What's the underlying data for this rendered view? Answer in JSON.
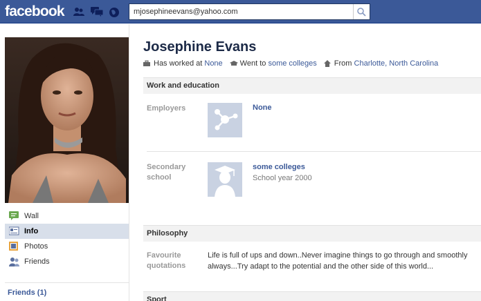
{
  "header": {
    "logo": "facebook",
    "search_value": "mjosephineevans@yahoo.com",
    "icons": [
      "friend-requests-icon",
      "messages-icon",
      "notifications-icon",
      "search-icon"
    ],
    "bar_color": "#3b5998"
  },
  "sidebar": {
    "items": [
      {
        "label": "Wall",
        "icon": "wall-icon"
      },
      {
        "label": "Info",
        "icon": "info-icon",
        "selected": true
      },
      {
        "label": "Photos",
        "icon": "photos-icon"
      },
      {
        "label": "Friends",
        "icon": "friends-icon"
      }
    ],
    "friends_link": "Friends (1)"
  },
  "profile": {
    "name": "Josephine Evans",
    "intro": {
      "worked_prefix": "Has worked at",
      "worked_link": "None",
      "went_prefix": "Went to",
      "went_link": "some colleges",
      "from_prefix": "From",
      "from_link": "Charlotte, North Carolina"
    }
  },
  "sections": {
    "work": {
      "title": "Work and education",
      "employers_label": "Employers",
      "employer_name": "None",
      "school_label": "Secondary school",
      "school_name": "some colleges",
      "school_year": "School year 2000"
    },
    "philosophy": {
      "title": "Philosophy",
      "quotes_label": "Favourite quotations",
      "quote": "Life is full of ups and down..Never imagine things to go through and smoothly always...Try adapt to the potential and the other side of this world..."
    },
    "sport": {
      "title": "Sport"
    }
  }
}
